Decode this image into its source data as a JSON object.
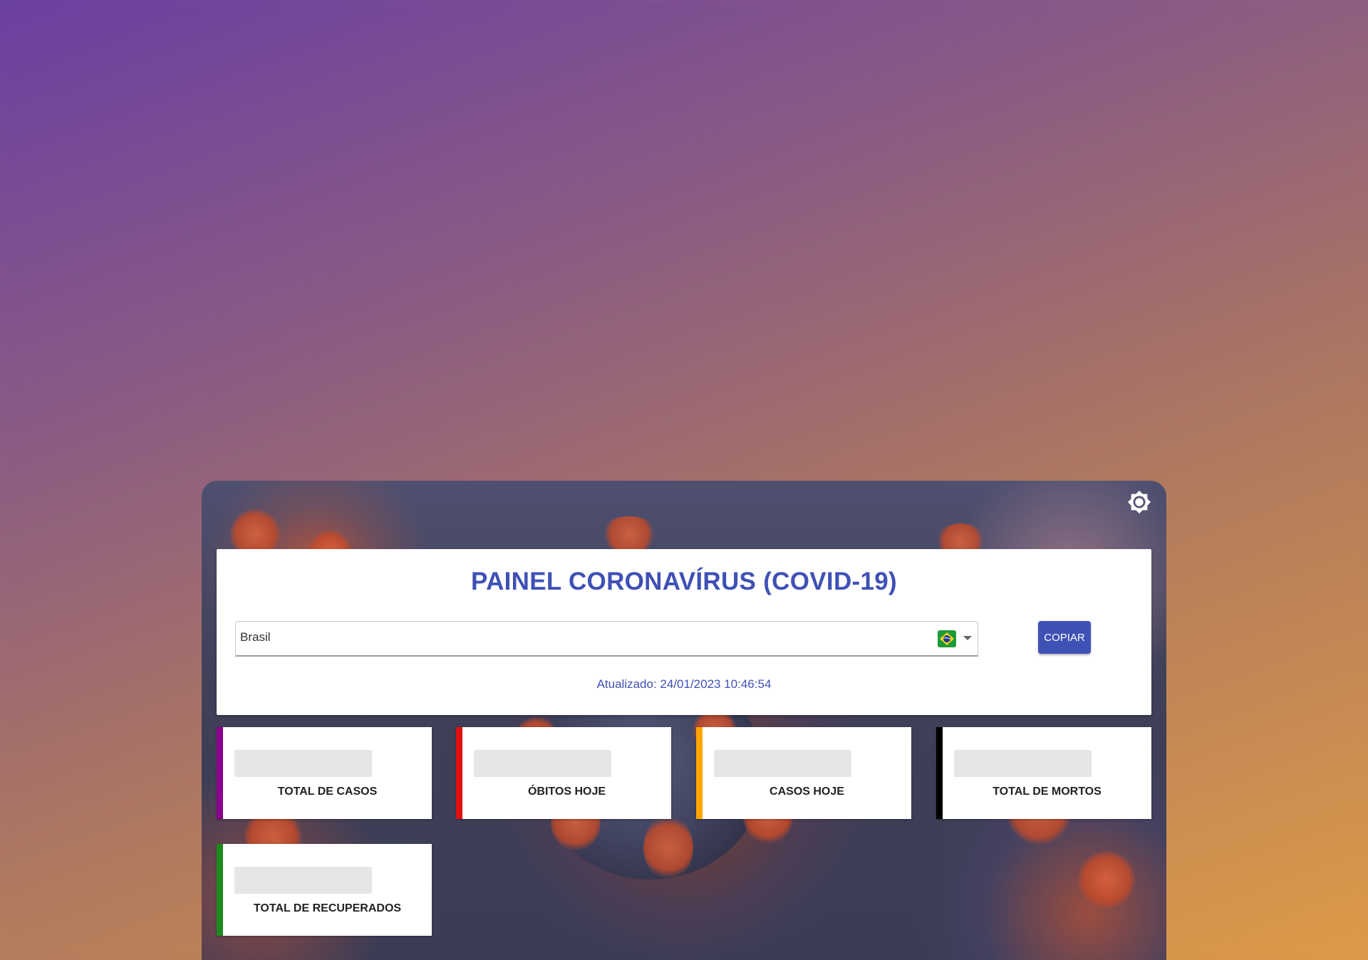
{
  "header": {
    "title": "PAINEL CORONAVÍRUS (COVID-19)",
    "updated": "Atualizado: 24/01/2023 10:46:54"
  },
  "country_select": {
    "value": "Brasil",
    "flag_icon": "brazil-flag-icon",
    "dropdown_icon": "chevron-down-icon"
  },
  "copy_button": {
    "label": "COPIAR"
  },
  "theme_toggle": {
    "icon": "brightness-icon"
  },
  "stats": [
    {
      "label": "TOTAL DE CASOS",
      "color": "#8b008b"
    },
    {
      "label": "ÓBITOS HOJE",
      "color": "#e01010"
    },
    {
      "label": "CASOS HOJE",
      "color": "#ffa500"
    },
    {
      "label": "TOTAL DE MORTOS",
      "color": "#000000"
    },
    {
      "label": "TOTAL DE RECUPERADOS",
      "color": "#1e8a1e"
    }
  ],
  "colors": {
    "primary": "#3f51b5",
    "background_start": "#6a3fa2",
    "background_end": "#de9a48"
  }
}
